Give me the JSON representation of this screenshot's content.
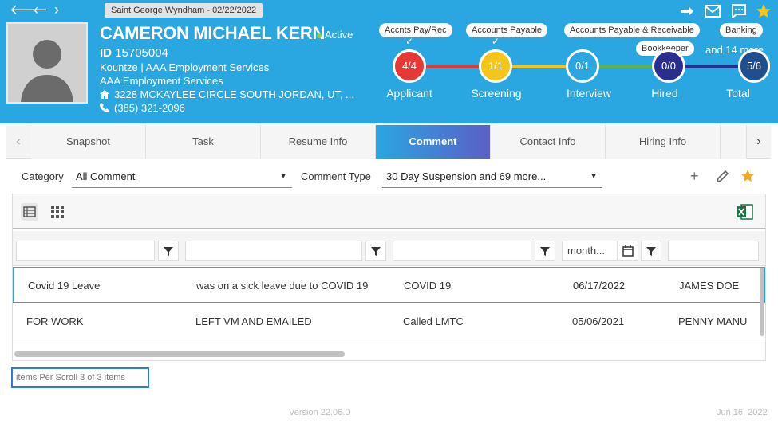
{
  "header": {
    "location_chip": "Saint George Wyndham - 02/22/2022",
    "candidate_name": "CAMERON MICHAEL KERN",
    "status": "Active",
    "id_label": "ID",
    "id_value": "15705004",
    "company_line": "Kountze | AAA Employment Services",
    "company_line2": "AAA Employment Services",
    "address": "3228 MCKAYLEE CIRCLE SOUTH JORDAN, UT, ...",
    "phone": "(385) 321-2096"
  },
  "role_pills": {
    "row1": [
      "Accnts Pay/Rec",
      "Accounts Payable",
      "Accounts Payable & Receivable",
      "Banking"
    ],
    "row2": [
      "Bookkeeper"
    ],
    "more": "and 14 more"
  },
  "pipeline": [
    {
      "count": "4/4",
      "label": "Applicant",
      "color": "#e53935"
    },
    {
      "count": "1/1",
      "label": "Screening",
      "color": "#f5c518"
    },
    {
      "count": "0/1",
      "label": "Interview",
      "color": "#2aa6e1"
    },
    {
      "count": "0/0",
      "label": "Hired",
      "color": "#2a2f8f"
    },
    {
      "count": "5/6",
      "label": "Total",
      "color": "#1f4f8f"
    }
  ],
  "tabs": [
    "Snapshot",
    "Task",
    "Resume Info",
    "Comment",
    "Contact Info",
    "Hiring Info"
  ],
  "active_tab": "Comment",
  "filters": {
    "category_label": "Category",
    "category_value": "All Comment",
    "comment_type_label": "Comment Type",
    "comment_type_value": "30 Day Suspension and 69 more..."
  },
  "grid": {
    "date_filter_placeholder": "month...",
    "rows": [
      {
        "c1": "Covid 19 Leave",
        "c2": "was on a sick leave due to COVID 19",
        "c3": "COVID 19",
        "c4": "06/17/2022",
        "c5": "JAMES DOE"
      },
      {
        "c1": "FOR WORK",
        "c2": "LEFT VM AND EMAILED",
        "c3": "Called LMTC",
        "c4": "05/06/2021",
        "c5": "PENNY MANU"
      }
    ]
  },
  "footer": {
    "items_text": "items Per Scroll 3 of 3 items",
    "version": "Version 22.06.0",
    "date": "Jun 16, 2022"
  },
  "colors": {
    "header_bg": "#2aa6e1",
    "accent": "#2aa6e1",
    "star": "#f5a623",
    "excel": "#1d7245"
  }
}
